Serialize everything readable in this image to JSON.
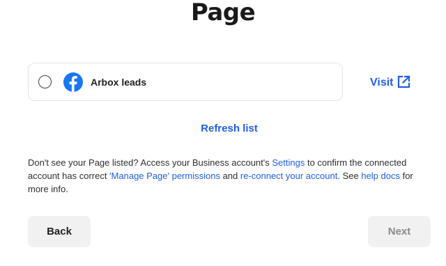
{
  "header": {
    "title": "Page"
  },
  "page_list": {
    "items": [
      {
        "name": "Arbox leads",
        "icon": "facebook-icon",
        "selected": false
      }
    ],
    "visit_label": "Visit",
    "visit_icon": "external-link-icon",
    "refresh_label": "Refresh list"
  },
  "help": {
    "part1": "Don't see your Page listed? Access your Business account's ",
    "settings_link": "Settings",
    "part2": " to confirm the connected account has correct ",
    "permissions_link": "'Manage Page' permissions",
    "part3": " and ",
    "reconnect_link": "re-connect your account",
    "part4": ". See ",
    "docs_link": "help docs",
    "part5": " for more info."
  },
  "footer": {
    "back_label": "Back",
    "next_label": "Next"
  },
  "colors": {
    "link": "#1f5ee8",
    "facebook": "#1877f2",
    "button_bg": "#f1f1f1"
  }
}
